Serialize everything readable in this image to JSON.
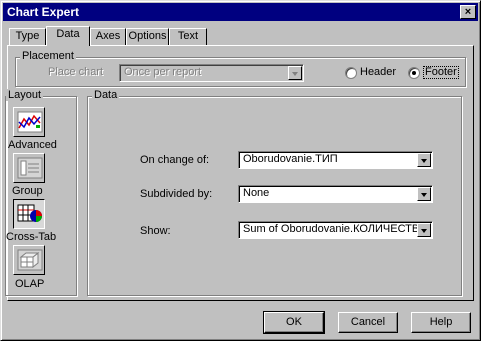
{
  "window": {
    "title": "Chart Expert",
    "close_glyph": "×"
  },
  "tabs": [
    {
      "label": "Type"
    },
    {
      "label": "Data"
    },
    {
      "label": "Axes"
    },
    {
      "label": "Options"
    },
    {
      "label": "Text"
    }
  ],
  "placement": {
    "legend": "Placement",
    "place_chart_label": "Place chart",
    "place_chart_value": "Once per report",
    "header_label": "Header",
    "footer_label": "Footer",
    "selected": "Footer"
  },
  "layout": {
    "legend": "Layout",
    "buttons": [
      {
        "label": "Advanced",
        "icon": "advanced-chart-icon"
      },
      {
        "label": "Group",
        "icon": "group-chart-icon"
      },
      {
        "label": "Cross-Tab",
        "icon": "cross-tab-icon",
        "selected": true
      },
      {
        "label": "OLAP",
        "icon": "olap-icon"
      }
    ]
  },
  "data": {
    "legend": "Data",
    "on_change_label": "On change of:",
    "on_change_value": "Oborudovanie.ТИП",
    "subdivided_label": "Subdivided by:",
    "subdivided_value": "None",
    "show_label": "Show:",
    "show_value": "Sum of Oborudovanie.КОЛИЧЕСТВО"
  },
  "buttons": {
    "ok": "OK",
    "cancel": "Cancel",
    "help": "Help"
  }
}
